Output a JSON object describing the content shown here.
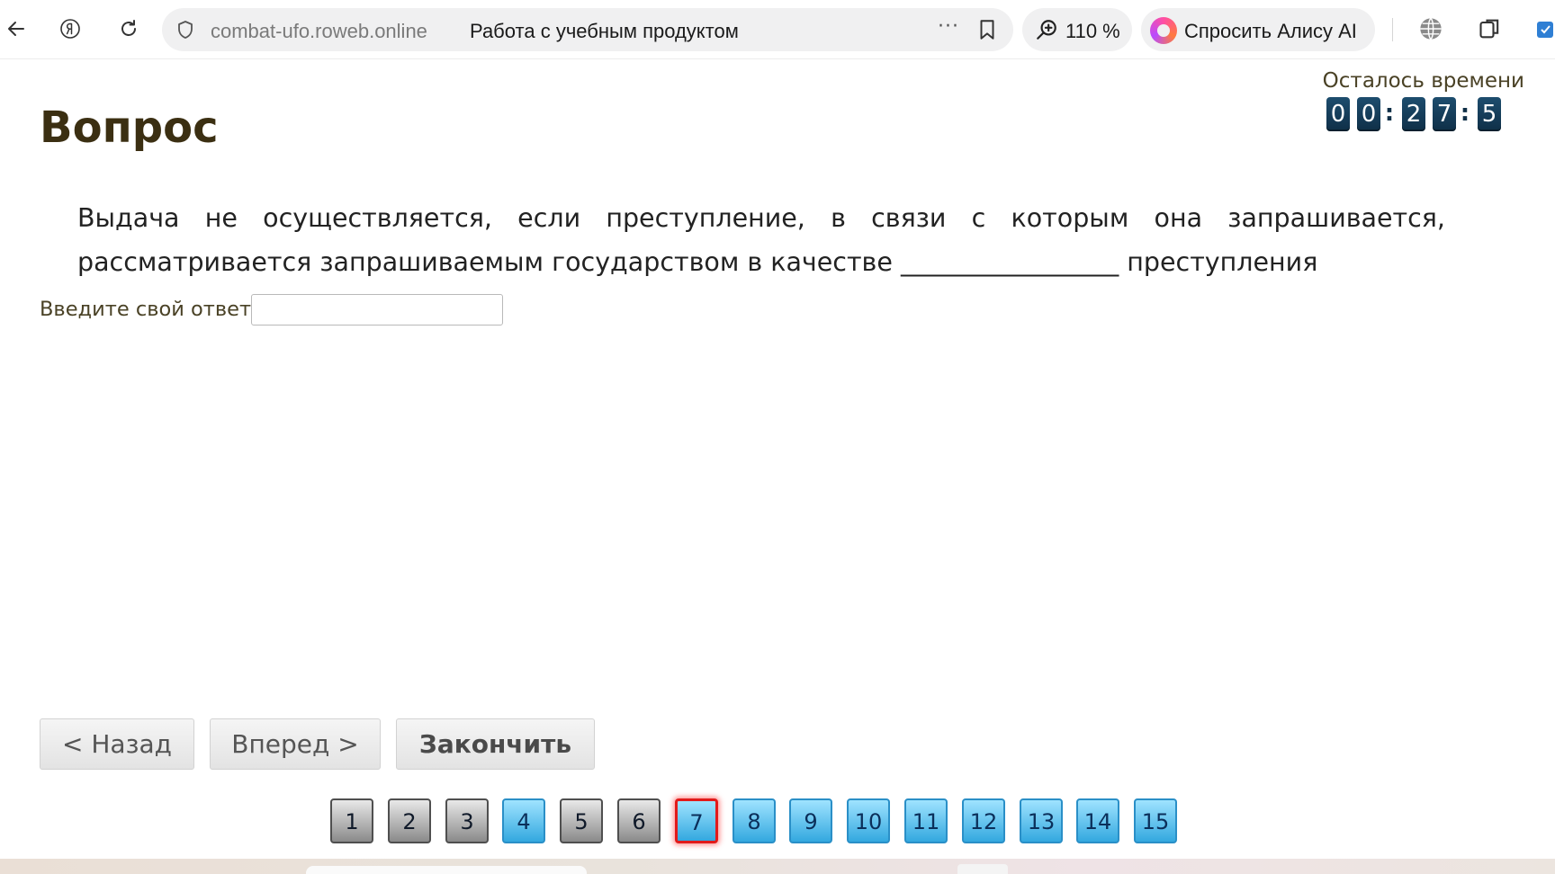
{
  "browser": {
    "domain": "combat-ufo.roweb.online",
    "page_title": "Работа с учебным продуктом",
    "more_label": "···",
    "zoom": "110 %",
    "alice_label": "Спросить Алису AI"
  },
  "page": {
    "heading": "Вопрос",
    "timer_label": "Осталось времени",
    "timer_digits": [
      "0",
      "0",
      ":",
      "2",
      "7",
      ":",
      "5"
    ],
    "question": "Выдача не осуществляется, если преступление, в связи с которым она запрашивается, рассматривается запрашиваемым государством в качестве _________________ преступления",
    "answer_label": "Введите свой ответ",
    "answer_value": ""
  },
  "nav": {
    "back": "< Назад",
    "forward": "Вперед >",
    "finish": "Закончить"
  },
  "pager": [
    {
      "label": "1",
      "state": "answered"
    },
    {
      "label": "2",
      "state": "answered"
    },
    {
      "label": "3",
      "state": "answered"
    },
    {
      "label": "4",
      "state": "pending"
    },
    {
      "label": "5",
      "state": "answered"
    },
    {
      "label": "6",
      "state": "answered"
    },
    {
      "label": "7",
      "state": "current"
    },
    {
      "label": "8",
      "state": "pending"
    },
    {
      "label": "9",
      "state": "pending"
    },
    {
      "label": "10",
      "state": "pending"
    },
    {
      "label": "11",
      "state": "pending"
    },
    {
      "label": "12",
      "state": "pending"
    },
    {
      "label": "13",
      "state": "pending"
    },
    {
      "label": "14",
      "state": "pending"
    },
    {
      "label": "15",
      "state": "pending"
    }
  ],
  "colors": {
    "heading": "#3b2f12",
    "label": "#4a4226",
    "timer_digit_bg": "#0f2f47",
    "pager_current_border": "#e21a1a",
    "pager_pending": "#33a8df",
    "pager_answered": "#8a8a8a"
  }
}
